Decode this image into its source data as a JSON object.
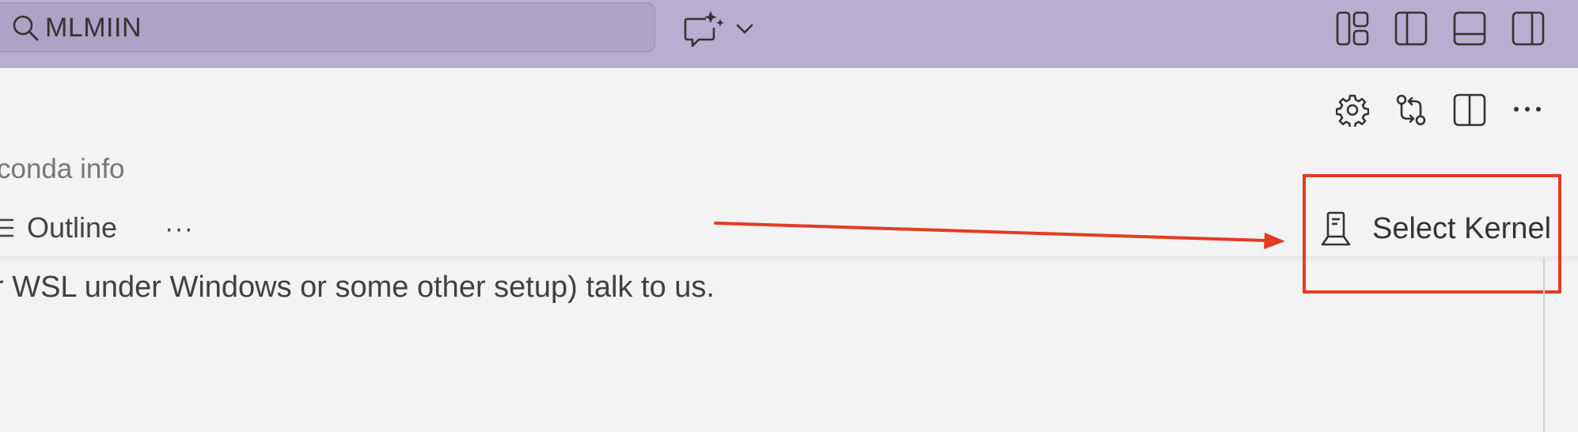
{
  "titlebar": {
    "search_value": "MLMIIN",
    "icons": [
      "search-icon",
      "chat-sparkle-icon",
      "chevron-down-icon",
      "customize-layout-icon",
      "toggle-primary-sidebar-icon",
      "toggle-panel-icon",
      "toggle-secondary-sidebar-icon"
    ]
  },
  "editor_toolbar": {
    "icons": [
      "gear-icon",
      "compare-changes-icon",
      "split-editor-icon",
      "more-actions-icon"
    ]
  },
  "breadcrumb": "conda info",
  "notebook_toolbar": {
    "outline_label": "Outline",
    "more_label": "···",
    "kernel_label": "Select Kernel"
  },
  "content": {
    "text": "r WSL under Windows or some other setup) talk to us."
  },
  "colors": {
    "titlebar_bg": "#b8aed0",
    "annotation_red": "#e23c22",
    "editor_bg": "#f3f3f3"
  }
}
